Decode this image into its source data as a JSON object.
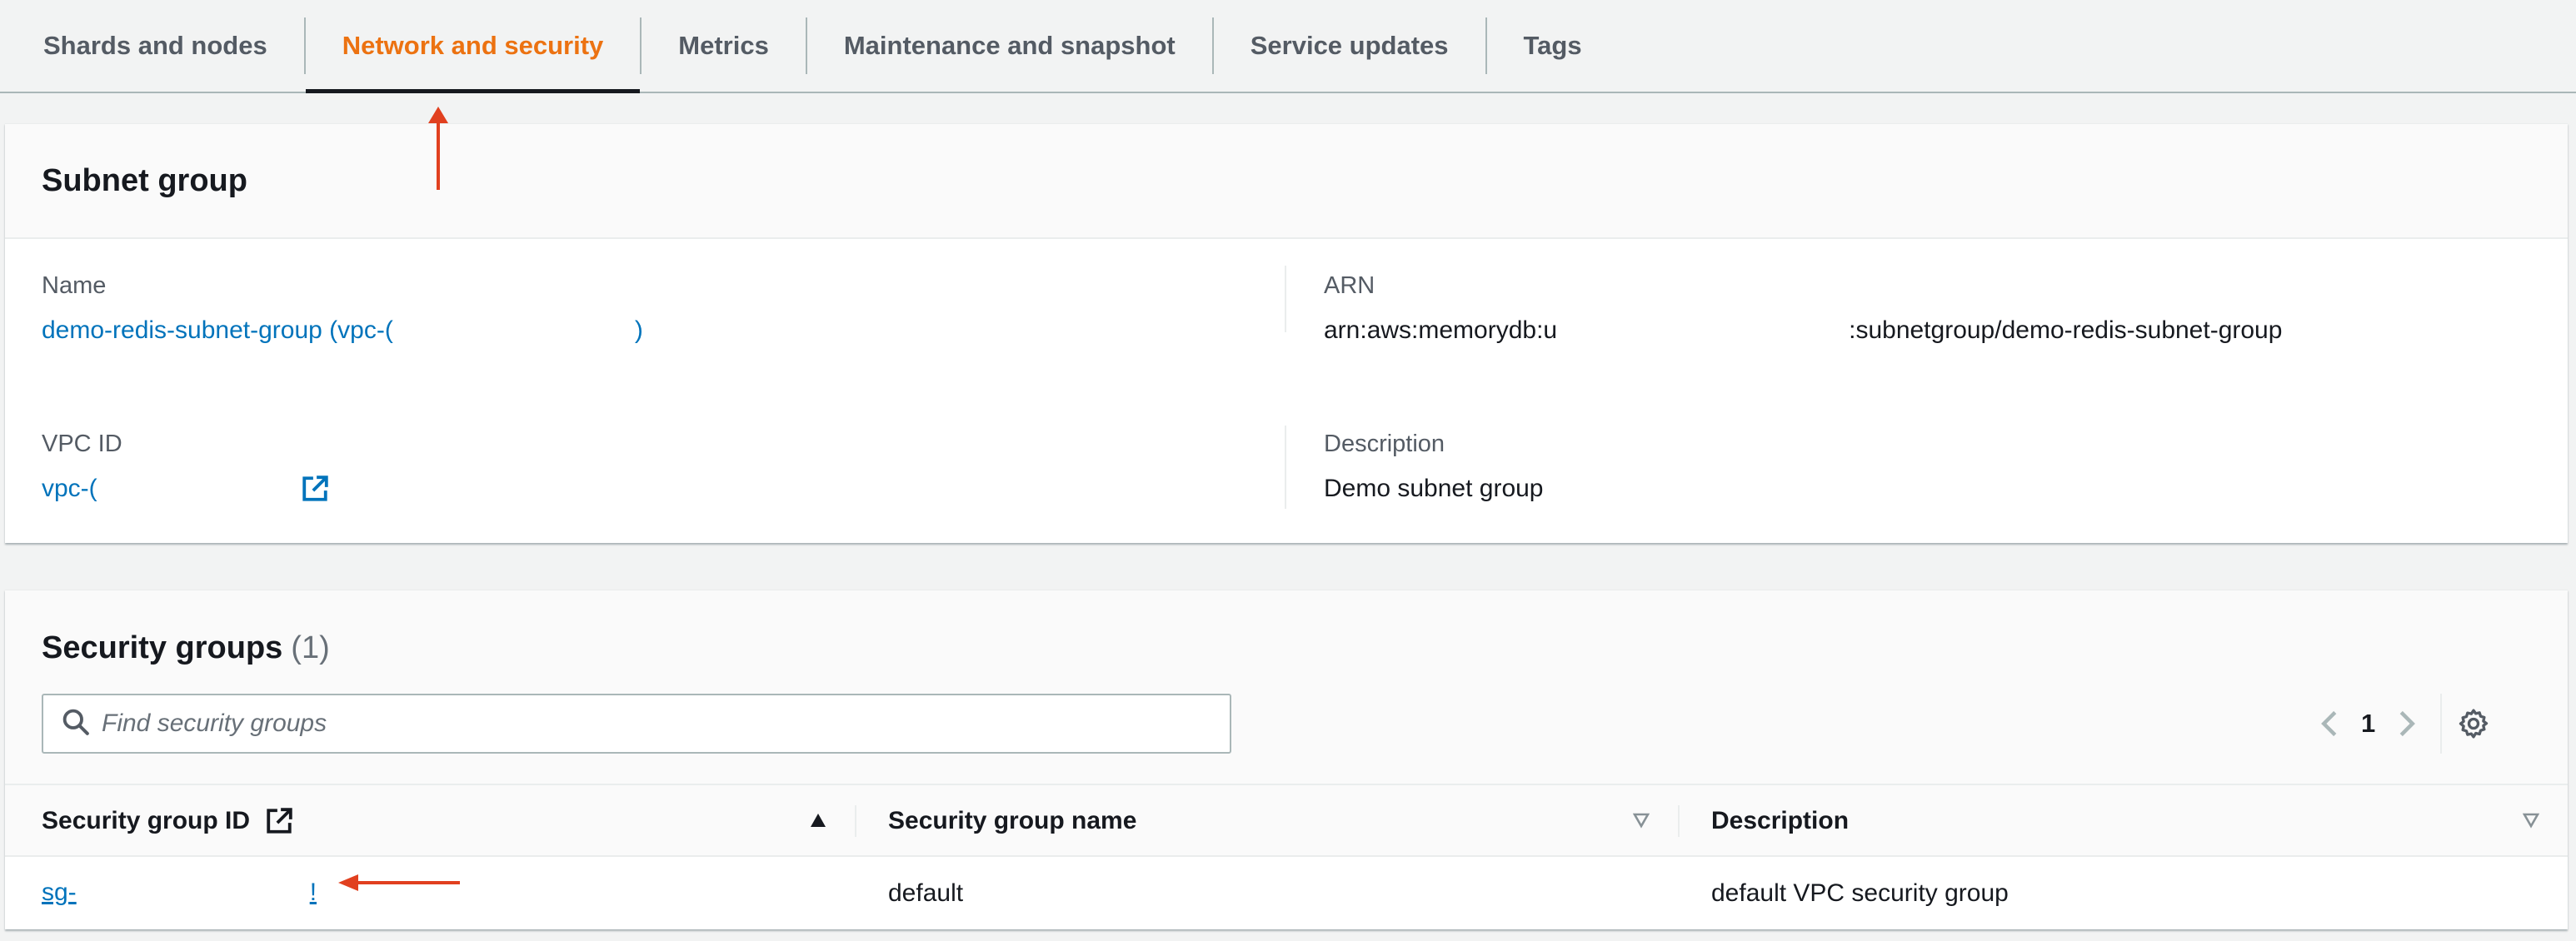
{
  "tabs": [
    {
      "label": "Shards and nodes",
      "active": false
    },
    {
      "label": "Network and security",
      "active": true
    },
    {
      "label": "Metrics",
      "active": false
    },
    {
      "label": "Maintenance and snapshot",
      "active": false
    },
    {
      "label": "Service updates",
      "active": false
    },
    {
      "label": "Tags",
      "active": false
    }
  ],
  "subnet_group": {
    "title": "Subnet group",
    "name_label": "Name",
    "name_value_start": "demo-redis-subnet-group (vpc-(",
    "name_value_end": ")",
    "arn_label": "ARN",
    "arn_value_start": "arn:aws:memorydb:u",
    "arn_value_end": ":subnetgroup/demo-redis-subnet-group",
    "vpc_label": "VPC ID",
    "vpc_value": "vpc-(",
    "description_label": "Description",
    "description_value": "Demo subnet group"
  },
  "security_groups": {
    "title": "Security groups",
    "count": "(1)",
    "search_placeholder": "Find security groups",
    "page": "1",
    "columns": [
      "Security group ID",
      "Security group name",
      "Description"
    ],
    "rows": [
      {
        "id_start": "sg-",
        "id_end": "!",
        "name": "default",
        "description": "default VPC security group"
      }
    ]
  },
  "colors": {
    "accent": "#ec7211",
    "link": "#0073bb",
    "annotation": "#e1401f"
  }
}
